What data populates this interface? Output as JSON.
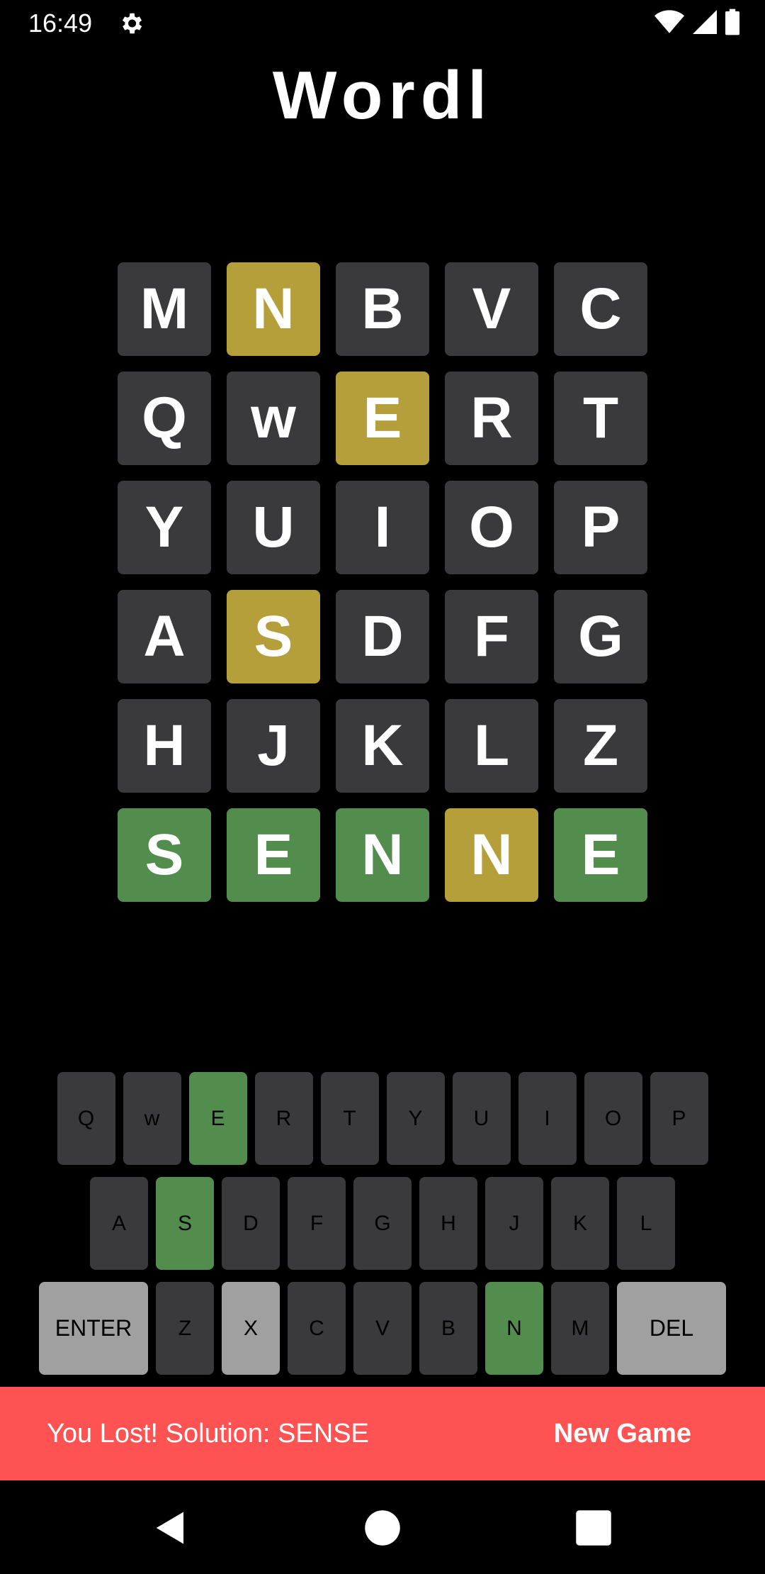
{
  "status": {
    "time": "16:49"
  },
  "app": {
    "title": "Wordl"
  },
  "colors": {
    "absent": "#3a3a3c",
    "present": "#b59f3b",
    "correct": "#538d4e",
    "used": "#a0a0a0",
    "snackbar": "#ff5252"
  },
  "board": [
    [
      {
        "letter": "M",
        "state": "absent"
      },
      {
        "letter": "N",
        "state": "present"
      },
      {
        "letter": "B",
        "state": "absent"
      },
      {
        "letter": "V",
        "state": "absent"
      },
      {
        "letter": "C",
        "state": "absent"
      }
    ],
    [
      {
        "letter": "Q",
        "state": "absent"
      },
      {
        "letter": "w",
        "state": "absent"
      },
      {
        "letter": "E",
        "state": "present"
      },
      {
        "letter": "R",
        "state": "absent"
      },
      {
        "letter": "T",
        "state": "absent"
      }
    ],
    [
      {
        "letter": "Y",
        "state": "absent"
      },
      {
        "letter": "U",
        "state": "absent"
      },
      {
        "letter": "I",
        "state": "absent"
      },
      {
        "letter": "O",
        "state": "absent"
      },
      {
        "letter": "P",
        "state": "absent"
      }
    ],
    [
      {
        "letter": "A",
        "state": "absent"
      },
      {
        "letter": "S",
        "state": "present"
      },
      {
        "letter": "D",
        "state": "absent"
      },
      {
        "letter": "F",
        "state": "absent"
      },
      {
        "letter": "G",
        "state": "absent"
      }
    ],
    [
      {
        "letter": "H",
        "state": "absent"
      },
      {
        "letter": "J",
        "state": "absent"
      },
      {
        "letter": "K",
        "state": "absent"
      },
      {
        "letter": "L",
        "state": "absent"
      },
      {
        "letter": "Z",
        "state": "absent"
      }
    ],
    [
      {
        "letter": "S",
        "state": "correct"
      },
      {
        "letter": "E",
        "state": "correct"
      },
      {
        "letter": "N",
        "state": "correct"
      },
      {
        "letter": "N",
        "state": "present"
      },
      {
        "letter": "E",
        "state": "correct"
      }
    ]
  ],
  "keyboard": {
    "rows": [
      [
        {
          "label": "Q",
          "state": "absent"
        },
        {
          "label": "w",
          "state": "absent"
        },
        {
          "label": "E",
          "state": "correct"
        },
        {
          "label": "R",
          "state": "absent"
        },
        {
          "label": "T",
          "state": "absent"
        },
        {
          "label": "Y",
          "state": "absent"
        },
        {
          "label": "U",
          "state": "absent"
        },
        {
          "label": "I",
          "state": "absent"
        },
        {
          "label": "O",
          "state": "absent"
        },
        {
          "label": "P",
          "state": "absent"
        }
      ],
      [
        {
          "label": "A",
          "state": "absent"
        },
        {
          "label": "S",
          "state": "correct"
        },
        {
          "label": "D",
          "state": "absent"
        },
        {
          "label": "F",
          "state": "absent"
        },
        {
          "label": "G",
          "state": "absent"
        },
        {
          "label": "H",
          "state": "absent"
        },
        {
          "label": "J",
          "state": "absent"
        },
        {
          "label": "K",
          "state": "absent"
        },
        {
          "label": "L",
          "state": "absent"
        }
      ],
      [
        {
          "label": "ENTER",
          "state": "used",
          "wide": true
        },
        {
          "label": "Z",
          "state": "absent"
        },
        {
          "label": "X",
          "state": "used"
        },
        {
          "label": "C",
          "state": "absent"
        },
        {
          "label": "V",
          "state": "absent"
        },
        {
          "label": "B",
          "state": "absent"
        },
        {
          "label": "N",
          "state": "correct"
        },
        {
          "label": "M",
          "state": "absent"
        },
        {
          "label": "DEL",
          "state": "used",
          "wide": true
        }
      ]
    ]
  },
  "snackbar": {
    "message": "You Lost! Solution: SENSE",
    "action": "New Game"
  },
  "icons": {
    "settings": "gear-icon",
    "wifi": "wifi-icon",
    "signal": "signal-icon",
    "battery": "battery-icon",
    "back": "back-icon",
    "home": "home-icon",
    "recents": "recents-icon"
  }
}
